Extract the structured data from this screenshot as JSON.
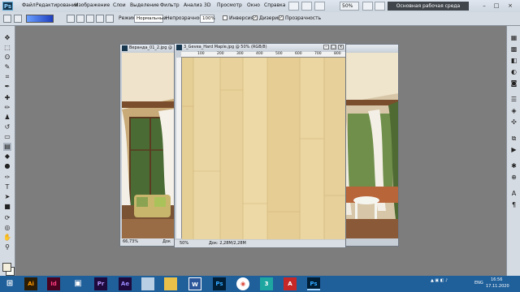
{
  "menubar": {
    "logo": "Ps",
    "items": [
      "Файл",
      "Редактирование",
      "Изображение",
      "Слои",
      "Выделение",
      "Фильтр",
      "Анализ",
      "3D",
      "Просмотр",
      "Окно",
      "Справка"
    ],
    "zoom": "50%",
    "workspace": "Основная рабочая среда"
  },
  "options": {
    "mode_label": "Режим:",
    "mode_value": "Нормальный",
    "opacity_label": "Непрозрачность:",
    "opacity_value": "100%",
    "inverse_label": "Инверсия",
    "dither_label": "Дизеринг",
    "transparency_label": "Прозрачность",
    "inverse_checked": false,
    "dither_checked": true,
    "transparency_checked": true
  },
  "documents": {
    "left": {
      "title": "Веранда_01_2.jpg @ 50%",
      "zoom": "66,73%",
      "status": "Док"
    },
    "front": {
      "title": "3_Gevea_Hard Maple.jpg @ 50% (RGB/8)",
      "zoom": "50%",
      "status": "Док: 2,28M/2,28M",
      "ruler": [
        "100",
        "200",
        "300",
        "400",
        "500",
        "600",
        "700",
        "800"
      ]
    },
    "right": {
      "title": ""
    }
  },
  "taskbar": {
    "apps": [
      "Ai",
      "Id",
      "Pr",
      "Ae",
      "W",
      "Ps",
      "3",
      "A",
      "Ps"
    ],
    "lang": "ENG",
    "time": "16:56",
    "date": "17.11.2020"
  },
  "colors": {
    "accent": "#1f5f9a",
    "canvas_bg": "#7d7d7d",
    "wood": "#ead49c"
  }
}
